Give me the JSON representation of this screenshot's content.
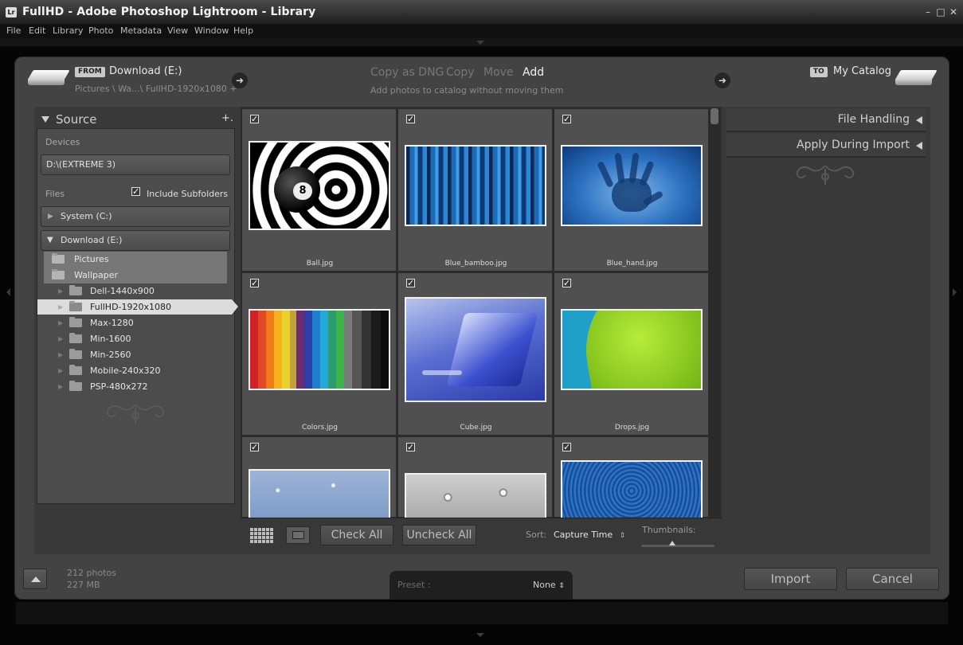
{
  "window": {
    "app_icon": "Lr",
    "title": "FullHD - Adobe Photoshop Lightroom - Library",
    "controls": [
      "minimize-icon",
      "maximize-icon",
      "close-icon"
    ]
  },
  "menu": [
    "File",
    "Edit",
    "Library",
    "Photo",
    "Metadata",
    "View",
    "Window",
    "Help"
  ],
  "header": {
    "from_badge": "FROM",
    "from_source": "Download (E:)",
    "from_path": "Pictures \\ Wa...\\ FullHD-1920x1080 +",
    "modes": [
      {
        "label": "Copy as DNG",
        "active": false
      },
      {
        "label": "Copy",
        "active": false
      },
      {
        "label": "Move",
        "active": false
      },
      {
        "label": "Add",
        "active": true
      }
    ],
    "mode_description": "Add photos to catalog without moving them",
    "to_badge": "TO",
    "to_destination": "My Catalog"
  },
  "source": {
    "title": "Source",
    "add_icon": "+.",
    "devices_label": "Devices",
    "device": "D:\\(EXTREME 3)",
    "files_label": "Files",
    "include_subfolders_label": "Include Subfolders",
    "include_subfolders_checked": true,
    "drives": [
      {
        "label": "System (C:)",
        "expanded": false
      },
      {
        "label": "Download (E:)",
        "expanded": true
      }
    ],
    "folders": [
      {
        "label": "Pictures",
        "level": 1,
        "selected": false,
        "highlight": true
      },
      {
        "label": "Wallpaper",
        "level": 1,
        "selected": false,
        "highlight": true
      },
      {
        "label": "Dell-1440x900",
        "level": 2,
        "selected": false,
        "highlight": false
      },
      {
        "label": "FullHD-1920x1080",
        "level": 2,
        "selected": true,
        "highlight": false
      },
      {
        "label": "Max-1280",
        "level": 2,
        "selected": false,
        "highlight": false
      },
      {
        "label": "Min-1600",
        "level": 2,
        "selected": false,
        "highlight": false
      },
      {
        "label": "Min-2560",
        "level": 2,
        "selected": false,
        "highlight": false
      },
      {
        "label": "Mobile-240x320",
        "level": 2,
        "selected": false,
        "highlight": false
      },
      {
        "label": "PSP-480x272",
        "level": 2,
        "selected": false,
        "highlight": false
      }
    ]
  },
  "photos": [
    {
      "name": "Ball.jpg",
      "checked": true
    },
    {
      "name": "Blue_bamboo.jpg",
      "checked": true
    },
    {
      "name": "Blue_hand.jpg",
      "checked": true
    },
    {
      "name": "Colors.jpg",
      "checked": true
    },
    {
      "name": "Cube.jpg",
      "checked": true
    },
    {
      "name": "Drops.jpg",
      "checked": true
    },
    {
      "name": "",
      "checked": true
    },
    {
      "name": "",
      "checked": true
    },
    {
      "name": "",
      "checked": true
    }
  ],
  "toolbar": {
    "grid_view_icon": "grid-icon",
    "loupe_view_icon": "loupe-icon",
    "check_all": "Check All",
    "uncheck_all": "Uncheck All",
    "sort_label": "Sort:",
    "sort_value": "Capture Time",
    "thumbnails_label": "Thumbnails:",
    "thumbnail_size": 0.42
  },
  "right_panel": {
    "sections": [
      "File Handling",
      "Apply During Import"
    ]
  },
  "footer": {
    "photo_count": "212 photos",
    "size": "227 MB",
    "preset_label": "Preset :",
    "preset_value": "None",
    "import": "Import",
    "cancel": "Cancel"
  }
}
